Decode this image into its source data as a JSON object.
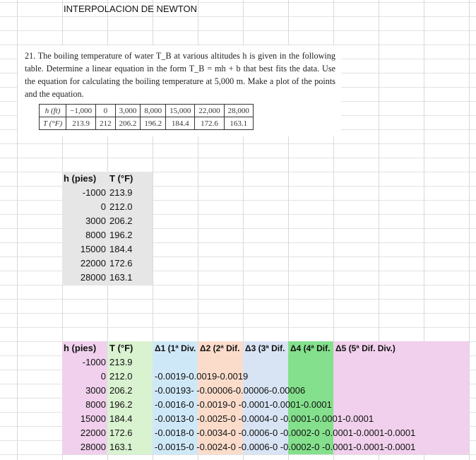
{
  "sheet_title": "INTERPOLACION DE NEWTON",
  "problem": {
    "statement": "21. The boiling temperature of water T_B at various altitudes h is given in the following table. Determine a linear equation in the form T_B = mh + b that best fits the data. Use the equation for calculating the boiling temperature at 5,000 m. Make a plot of the points and the equation.",
    "row_h_label": "h (ft)",
    "row_t_label": "T (°F)",
    "h_values": [
      "−1,000",
      "0",
      "3,000",
      "8,000",
      "15,000",
      "22,000",
      "28,000"
    ],
    "t_values": [
      "213.9",
      "212",
      "206.2",
      "196.2",
      "184.4",
      "172.6",
      "163.1"
    ]
  },
  "table1": {
    "headers": [
      "h (pies)",
      "T (°F)"
    ],
    "rows": [
      [
        "-1000",
        "213.9"
      ],
      [
        "0",
        "212.0"
      ],
      [
        "3000",
        "206.2"
      ],
      [
        "8000",
        "196.2"
      ],
      [
        "15000",
        "184.4"
      ],
      [
        "22000",
        "172.6"
      ],
      [
        "28000",
        "163.1"
      ]
    ]
  },
  "table2": {
    "headers": [
      "h (pies)",
      "T (°F)",
      "Δ1 (1ª Div.",
      "Δ2 (2ª Dif.",
      "Δ3 (3ª Dif.",
      "Δ4 (4ª Dif.",
      "Δ5 (5ª Dif. Div.)"
    ],
    "rows": [
      {
        "h": "-1000",
        "t": "213.9",
        "diffs": ""
      },
      {
        "h": "0",
        "t": "212.0",
        "diffs": "-0.0019-0.0019-0.0019"
      },
      {
        "h": "3000",
        "t": "206.2",
        "diffs": "-0.00193- -0.00006-0.00006-0.00006"
      },
      {
        "h": "8000",
        "t": "196.2",
        "diffs": "-0.0016-0 -0.0019-0 -0.0001-0.0001-0.0001"
      },
      {
        "h": "15000",
        "t": "184.4",
        "diffs": "-0.0013-0 -0.0025-0 -0.0004-0 -0.0001-0.0001-0.0001"
      },
      {
        "h": "22000",
        "t": "172.6",
        "diffs": "-0.0018-0 -0.0034-0 -0.0006-0 -0.0002-0 -0.0001-0.0001-0.0001"
      },
      {
        "h": "28000",
        "t": "163.1",
        "diffs": "-0.0015-0 -0.0024-0 -0.0006-0 -0.0002-0 -0.0001-0.0001-0.0001"
      }
    ]
  }
}
